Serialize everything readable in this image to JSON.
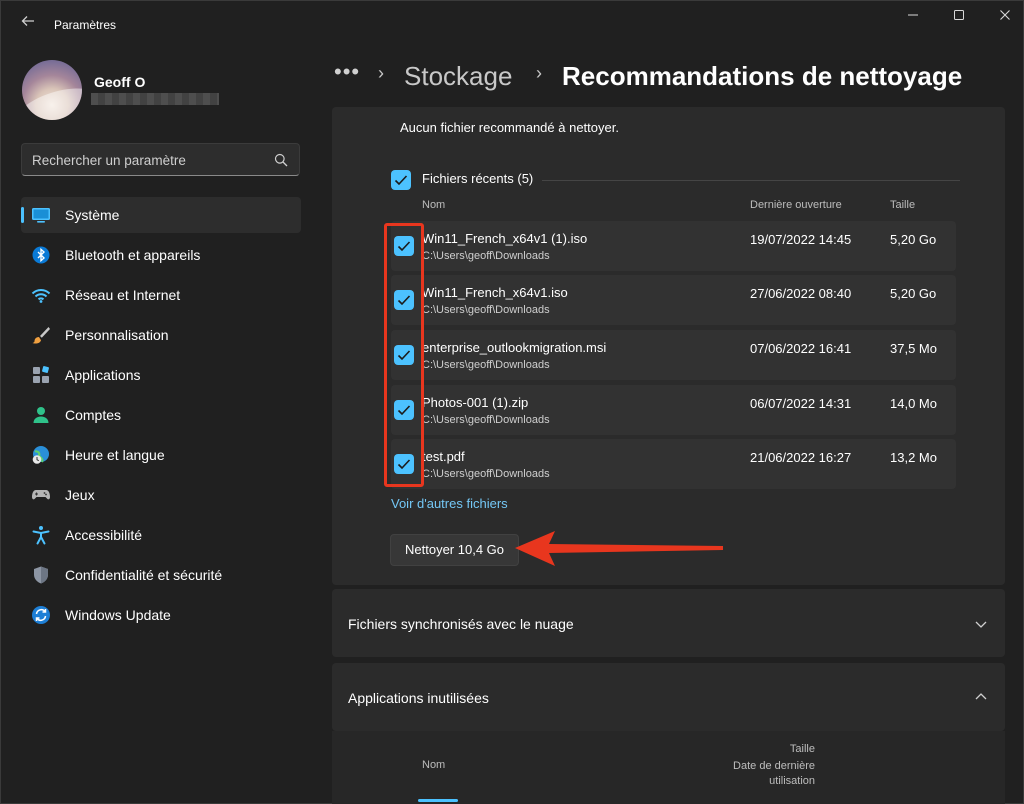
{
  "window": {
    "title": "Paramètres",
    "back_icon": "back-arrow-icon",
    "controls": [
      "minimize-icon",
      "maximize-icon",
      "close-icon"
    ]
  },
  "user": {
    "name": "Geoff O"
  },
  "search": {
    "placeholder": "Rechercher un paramètre",
    "icon": "search-icon"
  },
  "sidebar": {
    "items": [
      {
        "label": "Système",
        "icon": "system-icon",
        "active": true
      },
      {
        "label": "Bluetooth et appareils",
        "icon": "bluetooth-icon"
      },
      {
        "label": "Réseau et Internet",
        "icon": "wifi-icon"
      },
      {
        "label": "Personnalisation",
        "icon": "brush-icon"
      },
      {
        "label": "Applications",
        "icon": "apps-icon"
      },
      {
        "label": "Comptes",
        "icon": "person-icon"
      },
      {
        "label": "Heure et langue",
        "icon": "globe-clock-icon"
      },
      {
        "label": "Jeux",
        "icon": "gamepad-icon"
      },
      {
        "label": "Accessibilité",
        "icon": "accessibility-icon"
      },
      {
        "label": "Confidentialité et sécurité",
        "icon": "shield-icon"
      },
      {
        "label": "Windows Update",
        "icon": "update-icon"
      }
    ]
  },
  "header": {
    "dots": "•••",
    "separator": "›",
    "parent": "Stockage",
    "current": "Recommandations de nettoyage"
  },
  "content": {
    "no_recommendation": "Aucun fichier recommandé à nettoyer.",
    "section_title": "Fichiers récents (5)",
    "columns": {
      "name": "Nom",
      "last_opened": "Dernière ouverture",
      "size": "Taille"
    },
    "files": [
      {
        "name": "Win11_French_x64v1 (1).iso",
        "path": "C:\\Users\\geoff\\Downloads",
        "date": "19/07/2022 14:45",
        "size": "5,20 Go",
        "checked": true
      },
      {
        "name": "Win11_French_x64v1.iso",
        "path": "C:\\Users\\geoff\\Downloads",
        "date": "27/06/2022 08:40",
        "size": "5,20 Go",
        "checked": true
      },
      {
        "name": "enterprise_outlookmigration.msi",
        "path": "C:\\Users\\geoff\\Downloads",
        "date": "07/06/2022 16:41",
        "size": "37,5 Mo",
        "checked": true
      },
      {
        "name": "Photos-001 (1).zip",
        "path": "C:\\Users\\geoff\\Downloads",
        "date": "06/07/2022 14:31",
        "size": "14,0 Mo",
        "checked": true
      },
      {
        "name": "test.pdf",
        "path": "C:\\Users\\geoff\\Downloads",
        "date": "21/06/2022 16:27",
        "size": "13,2 Mo",
        "checked": true
      }
    ],
    "more_link": "Voir d'autres fichiers",
    "clean_button": "Nettoyer 10,4 Go"
  },
  "sections": {
    "cloud": {
      "title": "Fichiers synchronisés avec le nuage",
      "chevron": "chevron-down-icon"
    },
    "unused_apps": {
      "title": "Applications inutilisées",
      "chevron": "chevron-up-icon"
    }
  },
  "unused_apps_columns": {
    "name": "Nom",
    "size": "Taille",
    "last_used_line1": "Date de dernière",
    "last_used_line2": "utilisation"
  },
  "colors": {
    "accent": "#4cc2ff",
    "annotation_red": "#e8361e",
    "background": "#202020",
    "card": "#2b2b2b"
  }
}
